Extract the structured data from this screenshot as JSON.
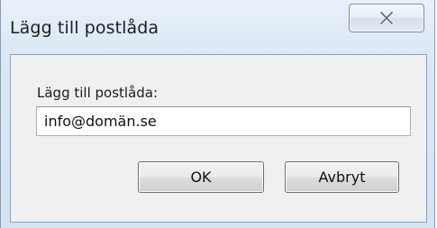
{
  "dialog": {
    "title": "Lägg till postlåda",
    "close_icon": "close-icon",
    "field_label": "Lägg till postlåda:",
    "field_value": "info@domän.se",
    "ok_label": "OK",
    "cancel_label": "Avbryt"
  }
}
